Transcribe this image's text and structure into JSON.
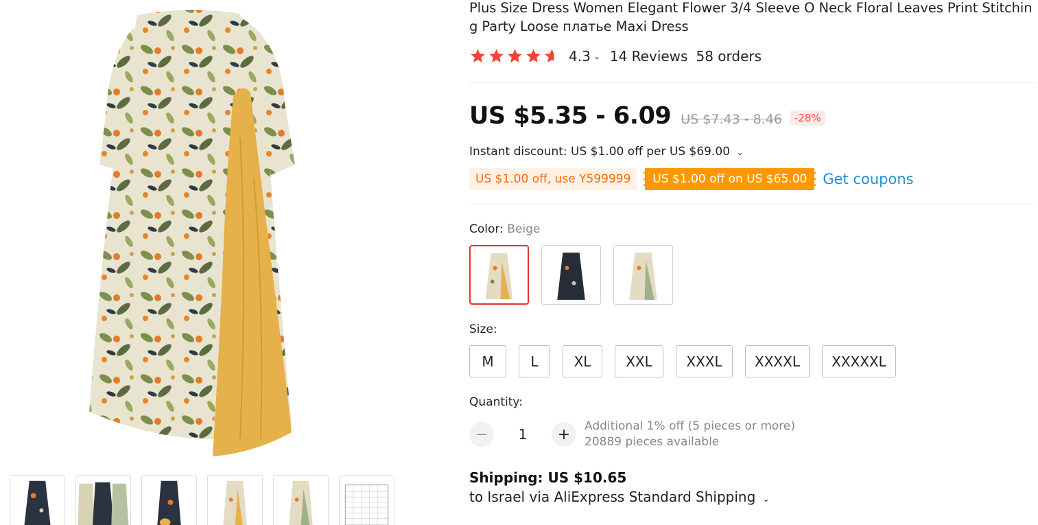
{
  "product": {
    "title": "Plus Size Dress Women Elegant Flower 3/4 Sleeve O Neck Floral Leaves Print Stitching Party Loose платье Maxi Dress",
    "rating": "4.3",
    "rating_stars": 4.3,
    "reviews": "14 Reviews",
    "orders": "58 orders"
  },
  "price": {
    "current": "US $5.35 - 6.09",
    "original": "US $7.43 - 8.46",
    "discount": "-28%"
  },
  "promo": {
    "instant_discount": "Instant discount: US $1.00 off per US $69.00",
    "coupon_code": "US $1.00 off, use Y599999",
    "coupon_store": "US $1.00 off on US $65.00",
    "get_coupons": "Get coupons"
  },
  "color": {
    "label": "Color:",
    "selected": "Beige",
    "options": [
      "Beige",
      "Black",
      "Green"
    ]
  },
  "size": {
    "label": "Size:",
    "options": [
      "M",
      "L",
      "XL",
      "XXL",
      "XXXL",
      "XXXXL",
      "XXXXXL"
    ]
  },
  "quantity": {
    "label": "Quantity:",
    "value": "1",
    "minus": "−",
    "plus": "+",
    "bulk_note": "Additional 1% off (5 pieces or more)",
    "available": "20889 pieces available"
  },
  "shipping": {
    "label": "Shipping: US $10.65",
    "detail": "to Israel via AliExpress Standard Shipping"
  },
  "icons": {
    "star": "star-icon",
    "half_star": "half-star-icon",
    "chevron": "chevron-down-icon"
  },
  "colors": {
    "star": "#f44336",
    "accent_red": "#e62e2e",
    "coupon_orange": "#ff9800",
    "link_blue": "#1a91d6"
  }
}
